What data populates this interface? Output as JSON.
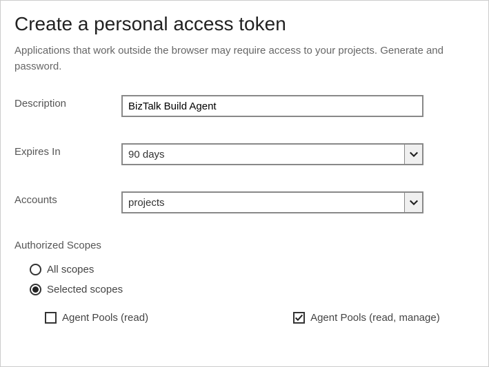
{
  "title": "Create a personal access token",
  "subtitle": "Applications that work outside the browser may require access to your projects. Generate and password.",
  "fields": {
    "description": {
      "label": "Description",
      "value": "BizTalk Build Agent"
    },
    "expires": {
      "label": "Expires In",
      "value": "90 days"
    },
    "accounts": {
      "label": "Accounts",
      "value": "projects"
    }
  },
  "scopes": {
    "section_label": "Authorized Scopes",
    "radios": {
      "all": "All scopes",
      "selected": "Selected scopes"
    },
    "checkboxes": {
      "read": "Agent Pools (read)",
      "manage": "Agent Pools (read, manage)"
    }
  }
}
